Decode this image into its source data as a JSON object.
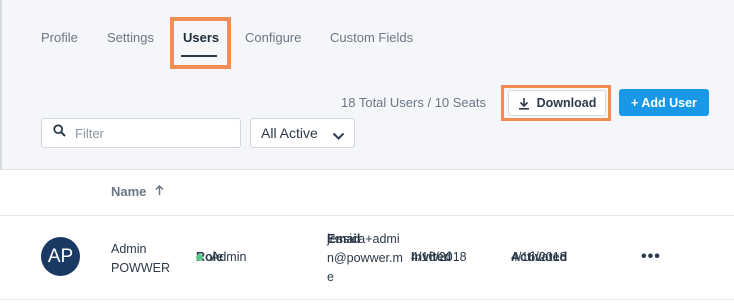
{
  "tabs": {
    "profile": "Profile",
    "settings": "Settings",
    "users": "Users",
    "configure": "Configure",
    "custom_fields": "Custom Fields"
  },
  "seats_summary": "18 Total Users / 10 Seats",
  "toolbar": {
    "download_label": "Download",
    "add_user_label": "+ Add User"
  },
  "filter": {
    "placeholder": "Filter",
    "value": ""
  },
  "status_select": {
    "value": "All Active"
  },
  "table": {
    "columns": {
      "name": "Name",
      "role": "Role",
      "email": "Email",
      "invited": "Invited",
      "activated": "Activated"
    },
    "rows": [
      {
        "initials": "AP",
        "first_name": "Admin",
        "last_name": "POWWER",
        "role": "Admin",
        "email": "jessica+admin@powwer.me",
        "invited": "4/16/2018",
        "activated": "4/16/2018",
        "more": "•••"
      }
    ]
  },
  "colors": {
    "accent": "#1a98e8",
    "avatar_bg": "#1b3a63",
    "active_dot": "#5cc98a",
    "highlight": "#f28c52"
  },
  "icons": {
    "search": "search-icon",
    "download": "download-icon",
    "chevron": "chevron-down-icon",
    "sort": "sort-ascending-icon",
    "more": "more-horizontal-icon"
  }
}
